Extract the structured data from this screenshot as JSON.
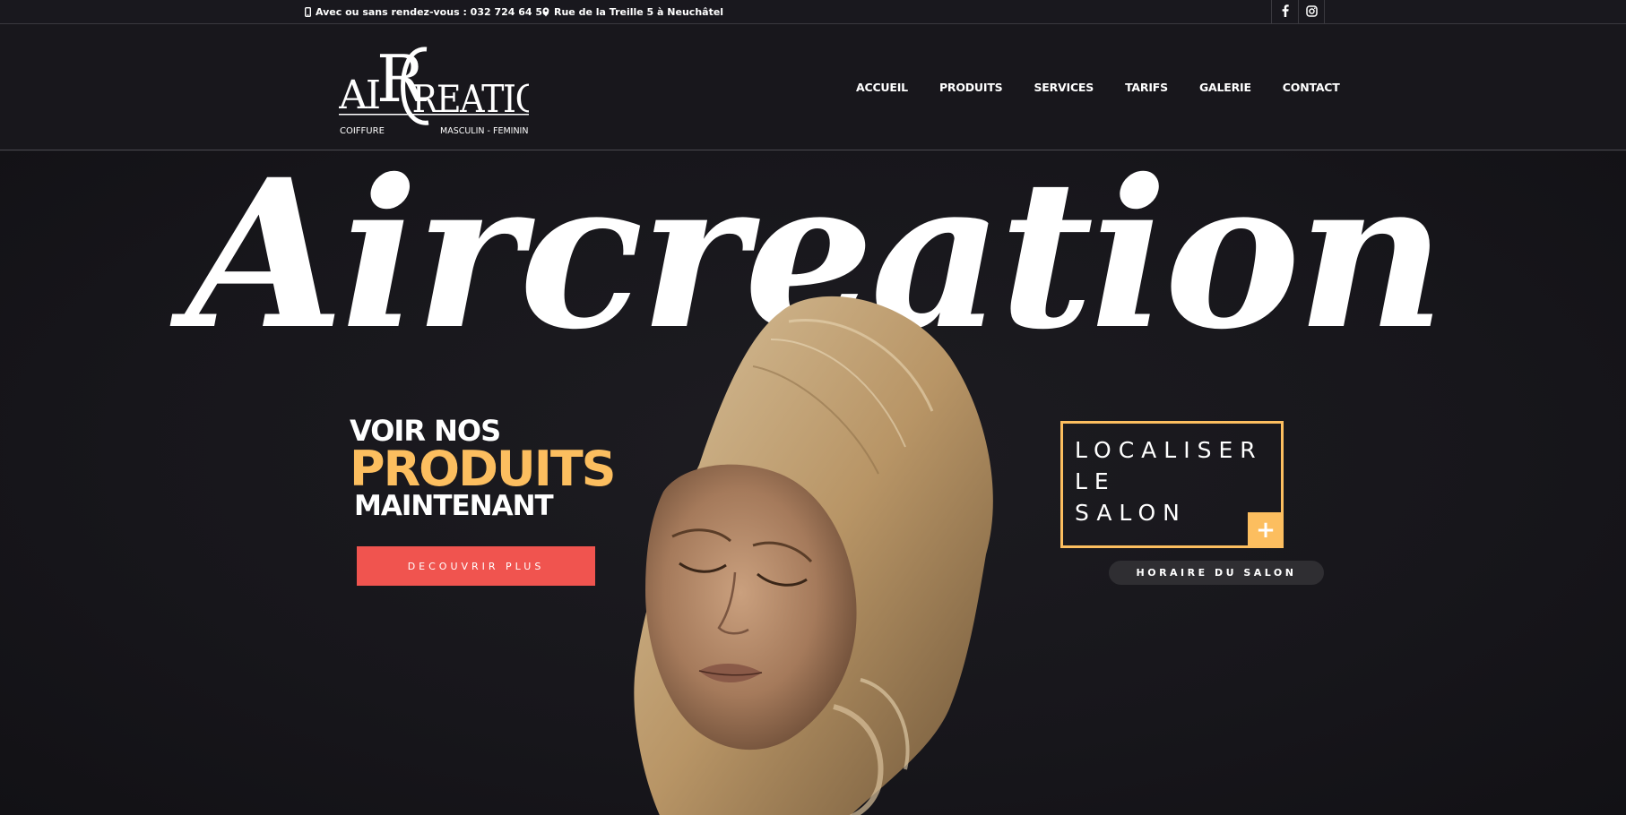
{
  "topbar": {
    "phone_text": "Avec ou sans rendez-vous : 032 724 64 50",
    "address_text": "Rue de la Treille 5 à Neuchâtel",
    "phone_icon": "mobile-phone-icon",
    "address_icon": "map-pin-icon",
    "social": [
      "facebook-icon",
      "instagram-icon"
    ]
  },
  "logo": {
    "wordmark": "AIRCREATION",
    "left_tagline": "COIFFURE",
    "right_tagline": "MASCULIN - FEMININ"
  },
  "nav": {
    "items": [
      "ACCUEIL",
      "PRODUITS",
      "SERVICES",
      "TARIFS",
      "GALERIE",
      "CONTACT"
    ]
  },
  "hero": {
    "title": "Aircreation",
    "promo": {
      "line1": "VOIR NOS",
      "line2": "PRODUITS",
      "line3": "MAINTENANT",
      "button": "DECOUVRIR PLUS"
    },
    "locate": {
      "lines": [
        "LOCALISER",
        "LE",
        "SALON"
      ],
      "plus": "+"
    },
    "hours_button": "HORAIRE DU SALON"
  },
  "colors": {
    "background": "#18171c",
    "accent_gold": "#fcbe5f",
    "accent_red": "#f0544f",
    "pill_gray": "#2f2e32"
  }
}
